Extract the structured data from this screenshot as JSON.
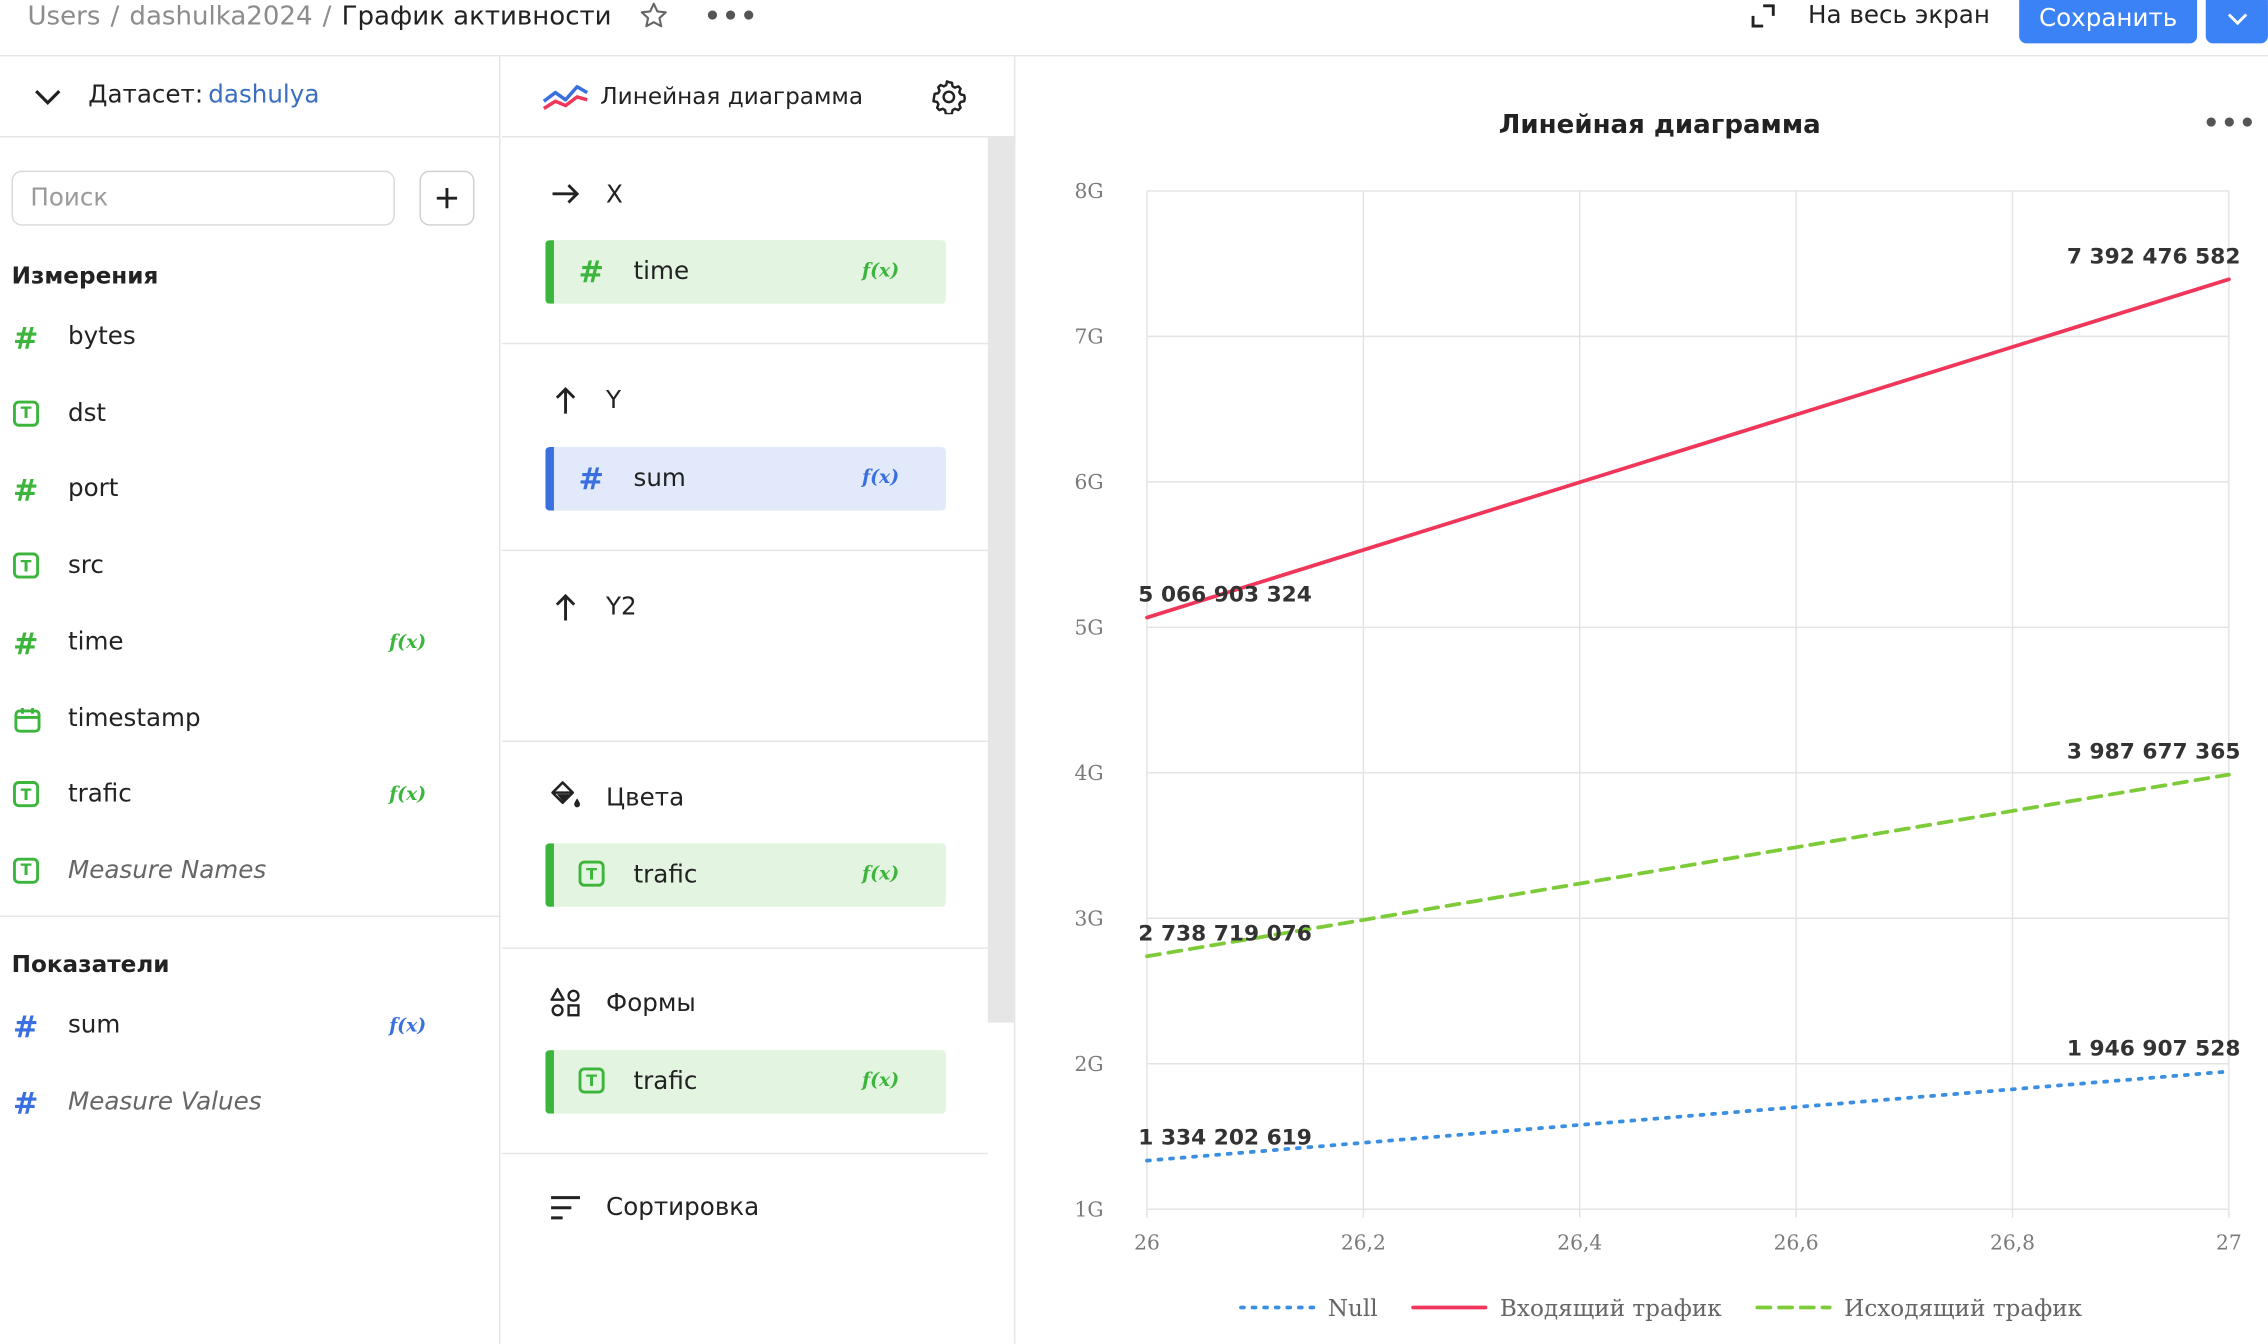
{
  "breadcrumbs": {
    "users": "Users",
    "user": "dashulka2024",
    "current": "График активности",
    "separator": "/"
  },
  "topbar": {
    "fullscreen_label": "На весь экран",
    "save_label": "Сохранить",
    "more_icon": "ellipsis-icon",
    "star_icon": "star-icon"
  },
  "dataset": {
    "label": "Датасет:",
    "name": "dashulya"
  },
  "search": {
    "placeholder": "Поиск"
  },
  "dimensions": {
    "title": "Измерения",
    "items": [
      {
        "name": "bytes",
        "type": "number",
        "fx": ""
      },
      {
        "name": "dst",
        "type": "text",
        "fx": ""
      },
      {
        "name": "port",
        "type": "number",
        "fx": ""
      },
      {
        "name": "src",
        "type": "text",
        "fx": ""
      },
      {
        "name": "time",
        "type": "number",
        "fx": "f(x)"
      },
      {
        "name": "timestamp",
        "type": "date",
        "fx": ""
      },
      {
        "name": "trafic",
        "type": "text",
        "fx": "f(x)"
      },
      {
        "name": "Measure Names",
        "type": "text",
        "fx": ""
      }
    ]
  },
  "measures": {
    "title": "Показатели",
    "items": [
      {
        "name": "sum",
        "type": "number",
        "fx": "f(x)"
      },
      {
        "name": "Measure Values",
        "type": "number",
        "fx": ""
      }
    ]
  },
  "visualization": {
    "type_label": "Линейная диаграмма",
    "sections": {
      "x": {
        "label": "X",
        "field": "time",
        "fx": "f(x)"
      },
      "y": {
        "label": "Y",
        "field": "sum",
        "fx": "f(x)"
      },
      "y2": {
        "label": "Y2"
      },
      "colors": {
        "label": "Цвета",
        "field": "trafic",
        "fx": "f(x)"
      },
      "shapes": {
        "label": "Формы",
        "field": "trafic",
        "fx": "f(x)"
      },
      "sort": {
        "label": "Сортировка"
      }
    }
  },
  "colors": {
    "accent": "#3b82f6",
    "dimension_green": "#3cb53c",
    "measure_blue": "#3a6fdf"
  },
  "chart_data": {
    "type": "line",
    "title": "Линейная диаграмма",
    "xlabel": "",
    "ylabel": "",
    "x_ticks": [
      "26",
      "26,2",
      "26,4",
      "26,6",
      "26,8",
      "27"
    ],
    "y_ticks": [
      "1G",
      "2G",
      "3G",
      "4G",
      "5G",
      "6G",
      "7G",
      "8G"
    ],
    "xlim": [
      26,
      27
    ],
    "ylim": [
      1000000000,
      8000000000
    ],
    "grid": true,
    "legend_position": "bottom",
    "series": [
      {
        "name": "Null",
        "color": "#3b8fe0",
        "style": "dotted",
        "x": [
          26,
          27
        ],
        "y": [
          1334202619,
          1946907528
        ],
        "labels": [
          "1 334 202 619",
          "1 946 907 528"
        ]
      },
      {
        "name": "Входящий трафик",
        "color": "#f0365a",
        "style": "solid",
        "x": [
          26,
          27
        ],
        "y": [
          5066903324,
          7392476582
        ],
        "labels": [
          "5 066 903 324",
          "7 392 476 582"
        ]
      },
      {
        "name": "Исходящий трафик",
        "color": "#7ecb3a",
        "style": "dashed",
        "x": [
          26,
          27
        ],
        "y": [
          2738719076,
          3987677365
        ],
        "labels": [
          "2 738 719 076",
          "3 987 677 365"
        ]
      }
    ]
  }
}
